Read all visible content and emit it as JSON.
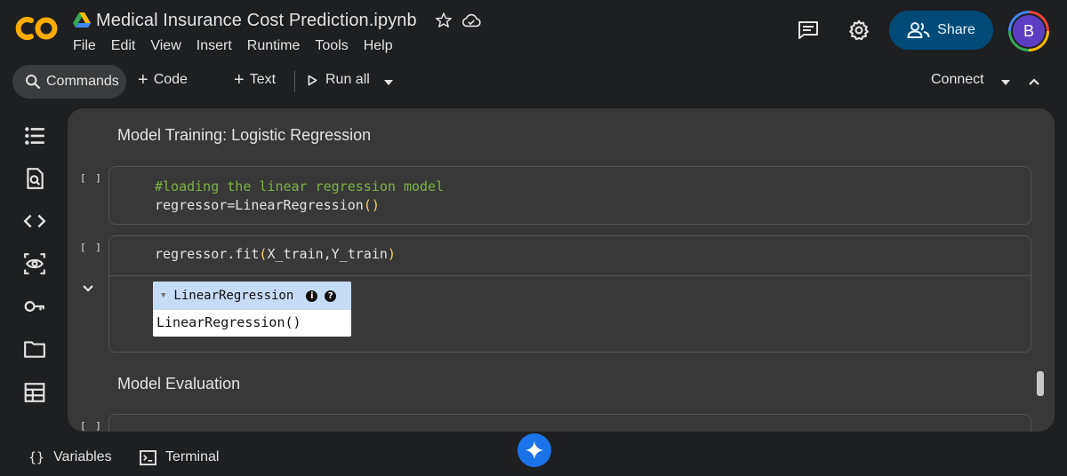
{
  "app": {
    "logo_text": "CO",
    "doc_title": "Medical Insurance Cost Prediction.ipynb"
  },
  "menu": [
    "File",
    "Edit",
    "View",
    "Insert",
    "Runtime",
    "Tools",
    "Help"
  ],
  "header": {
    "share_label": "Share",
    "avatar_initial": "B"
  },
  "toolbar": {
    "commands_label": "Commands",
    "code_label": "Code",
    "text_label": "Text",
    "run_all_label": "Run all",
    "connect_label": "Connect"
  },
  "notebook": {
    "section_training": "Model Training: Logistic Regression",
    "section_evaluation": "Model Evaluation",
    "run_marker": "[ ]",
    "run_marker_partial": "[ ]",
    "cell1": {
      "comment": "#loading the linear regression model",
      "code_prefix": "regressor=LinearRegression",
      "paren": "()"
    },
    "cell2": {
      "code_prefix": "regressor.fit",
      "paren_open": "(",
      "args": "X_train,Y_train",
      "paren_close": ")",
      "output": {
        "header": "LinearRegression",
        "info_glyph": "i",
        "help_glyph": "?",
        "body": "LinearRegression()"
      }
    }
  },
  "bottombar": {
    "variables_glyph": "{}",
    "variables_label": "Variables",
    "terminal_label": "Terminal"
  },
  "colors": {
    "background": "#1e1f21",
    "panel": "#383838",
    "share_button": "#004a77",
    "comment_green": "#7cb342",
    "paren_yellow": "#f5d36b",
    "logo_orange": "#f9ab00",
    "output_header": "#c5dcf7",
    "gemini_blue": "#1a73e8"
  }
}
